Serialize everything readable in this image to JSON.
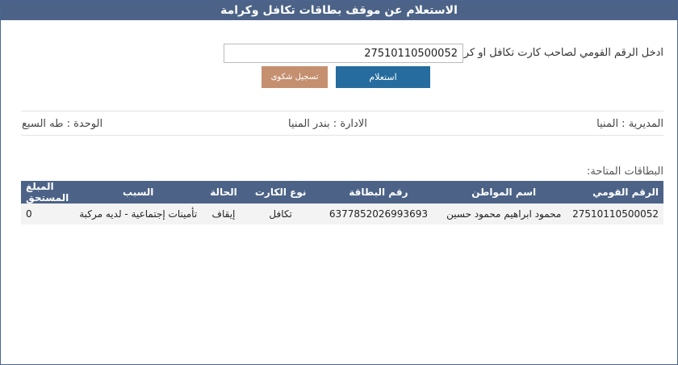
{
  "page": {
    "title": "الاستعلام عن موقف بطاقات تكافل وكرامة"
  },
  "query": {
    "prompt_label": "ادخل الرقم القومي لصاحب كارت تكافل او كرامة:",
    "national_id_value": "27510110500052",
    "query_button": "استعلام",
    "complaint_button": "تسجيل شكوى"
  },
  "location": {
    "directorate": "المديرية : المنيا",
    "administration": "الادارة : بندر المنيا",
    "unit": "الوحدة : طه السبع"
  },
  "cards": {
    "section_title": "البطاقات المتاحة:",
    "columns": [
      "الرقم القومي",
      "اسم المواطن",
      "رقم البطاقة",
      "نوع الكارت",
      "الحالة",
      "السبب",
      "المبلغ المستحق"
    ],
    "rows": [
      {
        "national_id": "27510110500052",
        "citizen_name": "محمود ابراهيم محمود حسين",
        "card_number": "6377852026993693",
        "card_type": "تكافل",
        "status": "إيقاف",
        "reason": "تأمينات إجتماعية - لديه مركبة",
        "amount_due": "0"
      }
    ]
  },
  "colors": {
    "header_bg": "#4c6387",
    "query_button_bg": "#266c9e",
    "complaint_button_bg": "#c59070"
  }
}
